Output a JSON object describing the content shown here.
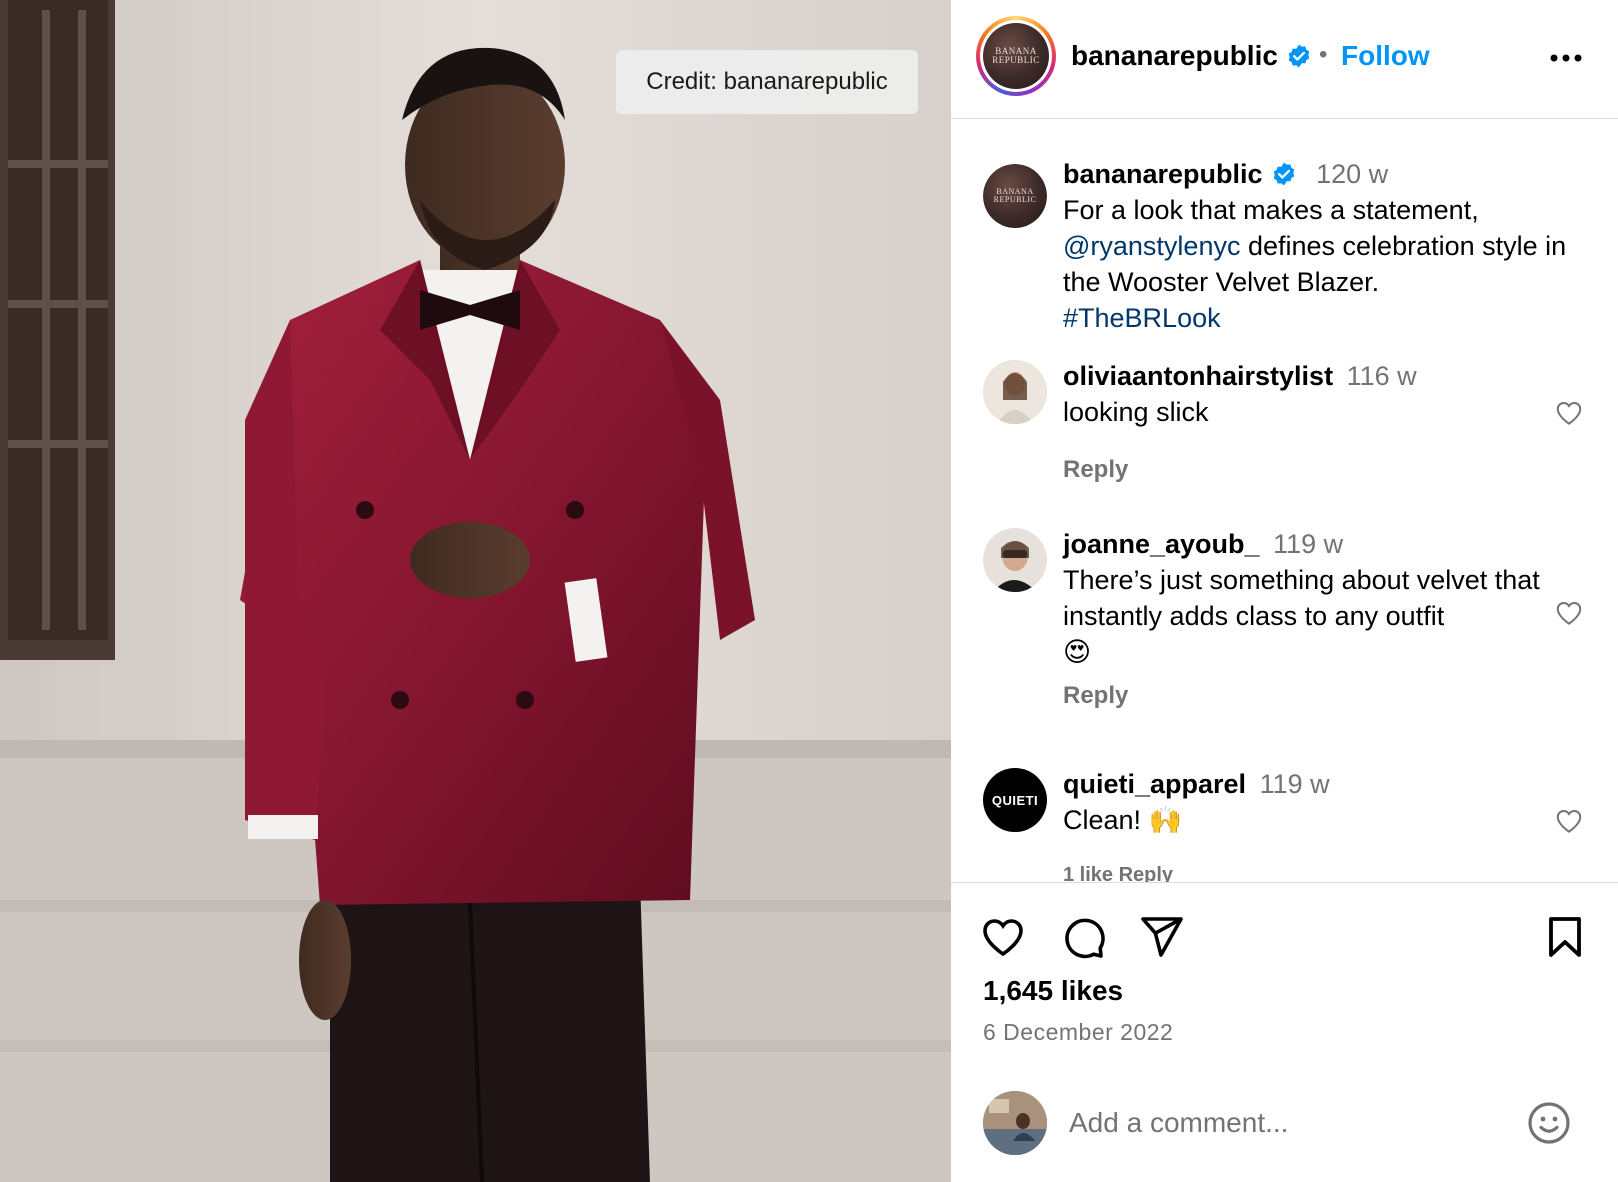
{
  "photo": {
    "credit": "Credit: bananarepublic"
  },
  "header": {
    "username": "bananarepublic",
    "avatar_text_line1": "BANANA",
    "avatar_text_line2": "REPUBLIC",
    "separator": "•",
    "follow_label": "Follow",
    "more_icon": "more-horizontal-icon"
  },
  "caption": {
    "username": "bananarepublic",
    "time": "120 w",
    "text_before": "For a look that makes a statement, ",
    "mention": "@ryanstylenyc",
    "text_after": " defines celebration style in the Wooster Velvet Blazer.",
    "hashtag": "#TheBRLook"
  },
  "comments": [
    {
      "username": "oliviaantonhairstylist",
      "time": "116 w",
      "text": "looking slick",
      "reply": "Reply"
    },
    {
      "username": "joanne_ayoub_",
      "time": "119 w",
      "text": "There’s just something about velvet that instantly adds class to any outfit",
      "emoji": "😍",
      "reply": "Reply"
    },
    {
      "username": "quieti_apparel",
      "time": "119 w",
      "text": "Clean!",
      "emoji": "🙌",
      "avatar_text": "QUIETI",
      "reply": "1 like   Reply"
    }
  ],
  "actions": {
    "icons": [
      "heart-icon",
      "comment-icon",
      "share-icon",
      "bookmark-icon"
    ],
    "likes": "1,645 likes",
    "date": "6 December 2022"
  },
  "comment_bar": {
    "placeholder": "Add a comment...",
    "emoji_icon": "smiley-icon"
  },
  "colors": {
    "link_blue": "#0095f6",
    "mention_blue": "#00376b",
    "muted_gray": "#737373",
    "divider": "#dbdbdb",
    "blazer_red": "#8a1530"
  }
}
